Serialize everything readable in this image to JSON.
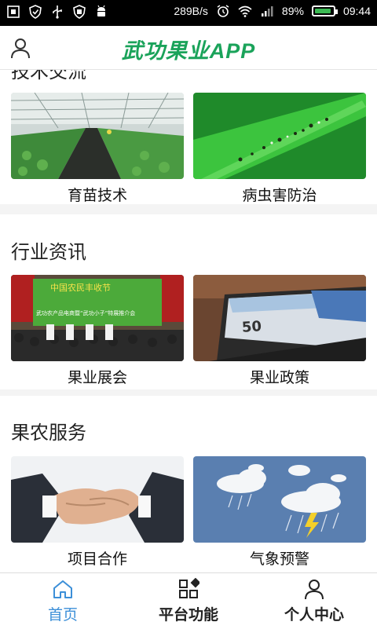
{
  "status_bar": {
    "speed": "289B/s",
    "battery_percent": "89%",
    "battery_level": 0.89,
    "time": "09:44",
    "left_icons": [
      "screenshot-icon",
      "shield-icon",
      "usb-icon",
      "shield-check-icon",
      "android-icon"
    ],
    "right_icons": [
      "alarm-icon",
      "wifi-icon",
      "signal-icon",
      "battery-icon"
    ]
  },
  "header": {
    "title": "武功果业APP",
    "brand_color": "#1aa35a"
  },
  "sections": [
    {
      "title": "技术交流",
      "cards": [
        {
          "label": "育苗技术"
        },
        {
          "label": "病虫害防治"
        }
      ]
    },
    {
      "title": "行业资讯",
      "cards": [
        {
          "label": "果业展会",
          "banner_text": "中国农民丰收节",
          "banner_subtext": "武功农产品电商暨“武功小子”特展推介会"
        },
        {
          "label": "果业政策",
          "banknote_value": "50"
        }
      ]
    },
    {
      "title": "果农服务",
      "cards": [
        {
          "label": "项目合作"
        },
        {
          "label": "气象预警"
        }
      ]
    }
  ],
  "bottom_nav": {
    "active_color": "#3c8fd8",
    "items": [
      {
        "label": "首页",
        "icon": "home-icon",
        "active": true
      },
      {
        "label": "平台功能",
        "icon": "grid-icon",
        "active": false
      },
      {
        "label": "个人中心",
        "icon": "person-icon",
        "active": false
      }
    ]
  }
}
